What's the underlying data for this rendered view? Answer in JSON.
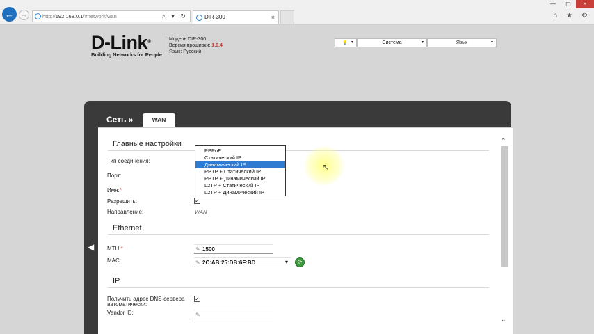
{
  "browser": {
    "url_prefix": "http://",
    "url_host": "192.168.0.1",
    "url_path": "/#network/wan",
    "url_tools": "⌕ ▾ ↻",
    "tab_title": "DIR-300",
    "tab_close": "×",
    "back_icon": "←",
    "forward_icon": "→",
    "window_buttons": [
      "—",
      "▢",
      "×"
    ],
    "right_icons": "⌂ ★ ⚙"
  },
  "header": {
    "logo": "D-Link",
    "logo_mark": "®",
    "tagline": "Building Networks for People",
    "model_line": "Модель DIR-300",
    "firmware_label": "Версия прошивки:",
    "firmware_version": "1.0.4",
    "language_line": "Язык: Русский",
    "menu_bulb": "💡",
    "menu_system": "Система",
    "menu_language": "Язык",
    "caret": "▾"
  },
  "panel": {
    "title": "Сеть »",
    "tab": "WAN",
    "collapse_icon": "◀",
    "scroll_up": "⌃",
    "scroll_down": "⌄"
  },
  "main_settings": {
    "section_title": "Главные настройки",
    "labels": {
      "connection_type": "Тип соединения:",
      "port": "Порт:",
      "name": "Имя:",
      "allow": "Разрешить:",
      "direction": "Направление:"
    },
    "required_mark": "*",
    "allow_checked": "✓",
    "direction_value": "WAN"
  },
  "dropdown": {
    "options": [
      "PPPoE",
      "Статический IP",
      "Динамический IP",
      "PPTP + Статический IP",
      "PPTP + Динамический IP",
      "L2TP + Статический IP",
      "L2TP + Динамический IP"
    ],
    "selected_index": 2
  },
  "ethernet": {
    "section_title": "Ethernet",
    "mtu_label": "MTU:",
    "mtu_value": "1500",
    "mac_label": "MAC:",
    "mac_value": "2C:AB:25:DB:6F:BD",
    "mac_caret": "▾",
    "mac_button_icon": "⟳",
    "pen_icon": "✎"
  },
  "ip": {
    "section_title": "IP",
    "dns_label": "Получить адрес DNS-сервера автоматически:",
    "dns_checked": "✓",
    "vendor_label": "Vendor ID:"
  },
  "cursor_icon": "↖"
}
